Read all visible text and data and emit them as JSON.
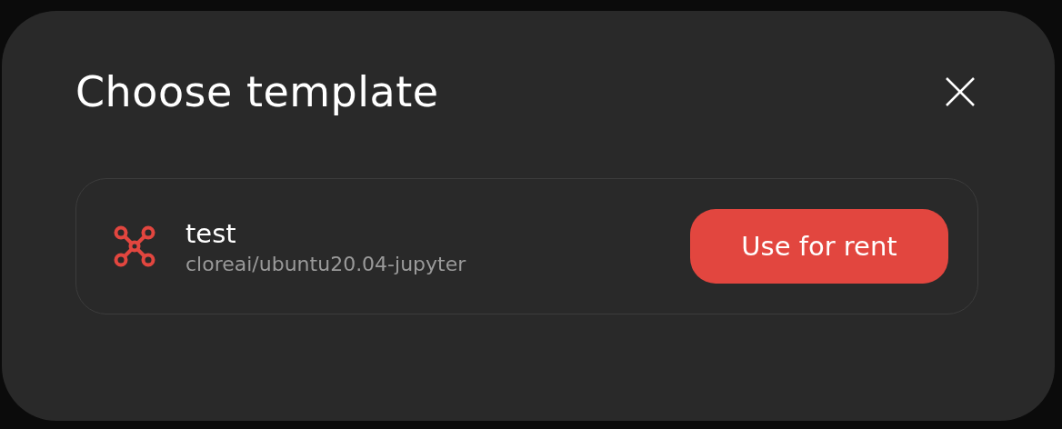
{
  "dialog": {
    "title": "Choose template"
  },
  "templates": [
    {
      "name": "test",
      "image": "cloreai/ubuntu20.04-jupyter",
      "action": "Use for rent"
    }
  ]
}
